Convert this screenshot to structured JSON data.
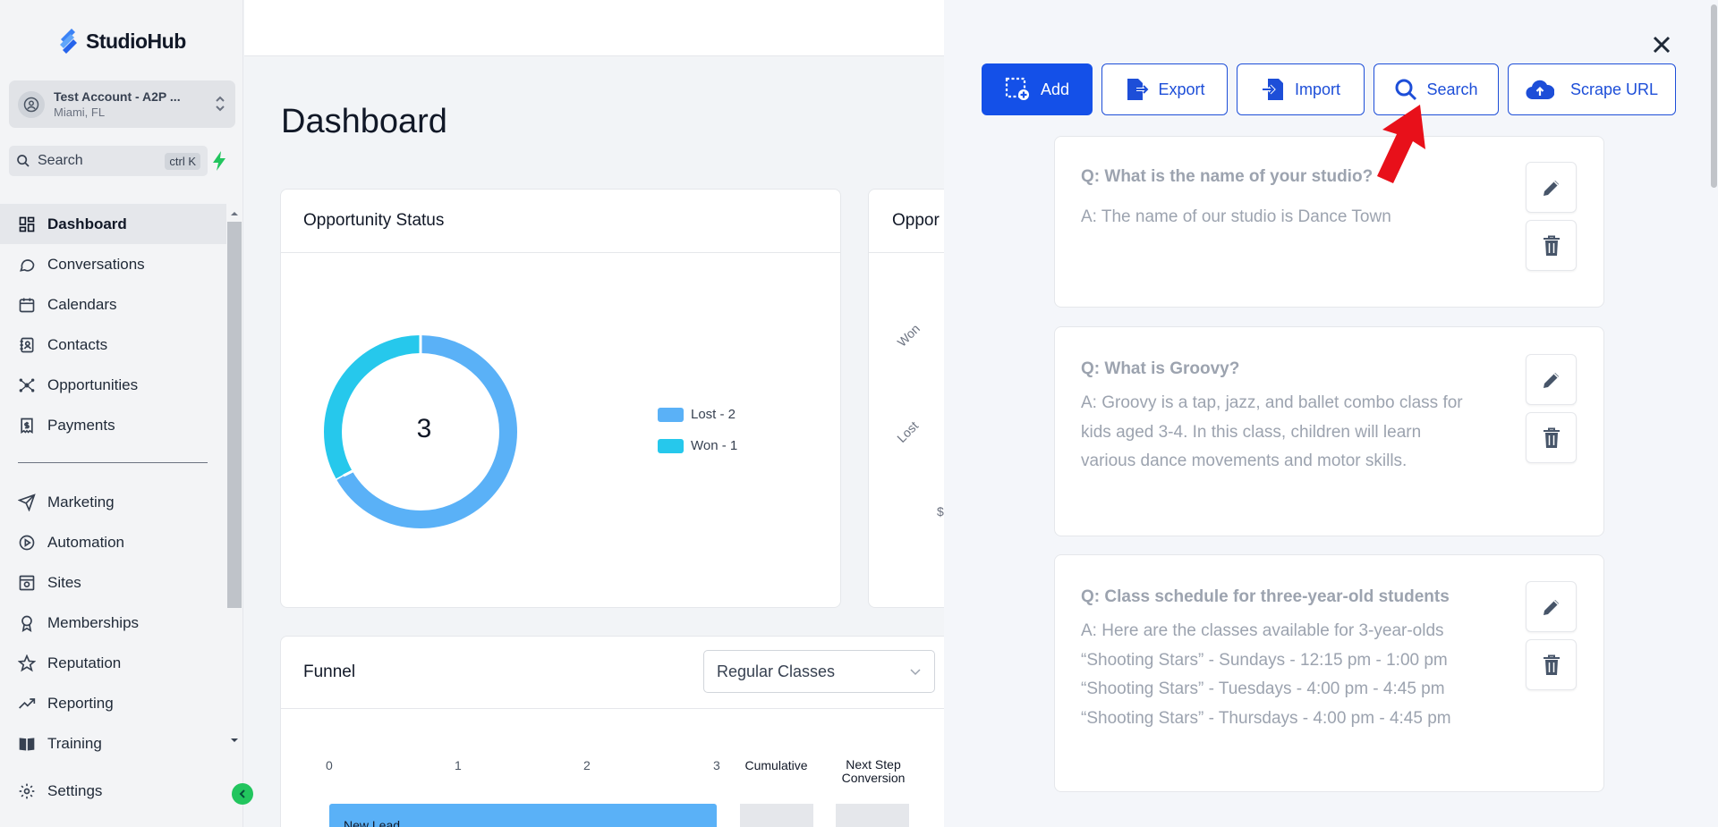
{
  "app": {
    "brand": "StudioHub"
  },
  "account": {
    "name": "Test Account - A2P ...",
    "location": "Miami, FL"
  },
  "search": {
    "label": "Search",
    "shortcut": "ctrl K"
  },
  "nav": {
    "items": [
      {
        "label": "Dashboard",
        "icon": "dashboard-icon"
      },
      {
        "label": "Conversations",
        "icon": "chat-icon"
      },
      {
        "label": "Calendars",
        "icon": "calendar-icon"
      },
      {
        "label": "Contacts",
        "icon": "contacts-icon"
      },
      {
        "label": "Opportunities",
        "icon": "opportunities-icon"
      },
      {
        "label": "Payments",
        "icon": "payments-icon"
      }
    ],
    "items2": [
      {
        "label": "Marketing",
        "icon": "send-icon"
      },
      {
        "label": "Automation",
        "icon": "automation-icon"
      },
      {
        "label": "Sites",
        "icon": "sites-icon"
      },
      {
        "label": "Memberships",
        "icon": "award-icon"
      },
      {
        "label": "Reputation",
        "icon": "star-icon"
      },
      {
        "label": "Reporting",
        "icon": "trend-icon"
      },
      {
        "label": "Training",
        "icon": "book-icon"
      }
    ],
    "settings": "Settings"
  },
  "main": {
    "title": "Dashboard",
    "opportunity_status": {
      "title": "Opportunity Status",
      "total": "3",
      "legend": [
        {
          "label": "Lost - 2",
          "color": "#5ab1f7"
        },
        {
          "label": "Won - 1",
          "color": "#26c8ec"
        }
      ]
    },
    "opportunity_value": {
      "title_truncated": "Oppor",
      "labels": [
        "Won",
        "Lost",
        "$"
      ]
    },
    "funnel": {
      "title": "Funnel",
      "pipeline": "Regular Classes",
      "ticks": [
        "0",
        "1",
        "2",
        "3"
      ],
      "col_cumulative": "Cumulative",
      "col_next_step": "Next Step Conversion",
      "bar_label": "New Lead"
    }
  },
  "panel": {
    "buttons": {
      "add": "Add",
      "export": "Export",
      "import": "Import",
      "search": "Search",
      "scrape": "Scrape URL"
    },
    "faqs": [
      {
        "q": "Q: What is the name of your studio?",
        "a": "A: The name of our studio is Dance Town"
      },
      {
        "q": "Q: What is Groovy?",
        "a": "A: Groovy is a tap, jazz, and ballet combo class for kids aged 3-4. In this class, children will learn various dance movements and motor skills."
      },
      {
        "q": "Q: Class schedule for three-year-old students",
        "a": "A: Here are the classes available for 3-year-olds “Shooting Stars” - Sundays - 12:15 pm - 1:00 pm “Shooting Stars” - Tuesdays - 4:00 pm - 4:45 pm “Shooting Stars” - Thursdays - 4:00 pm - 4:45 pm"
      }
    ]
  }
}
